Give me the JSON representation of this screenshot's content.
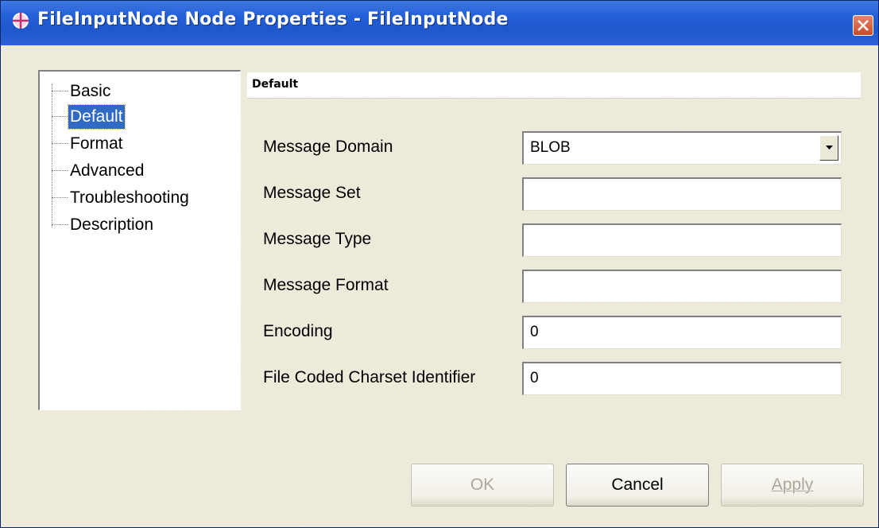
{
  "window": {
    "title": "FileInputNode Node Properties - FileInputNode",
    "title_icon": "node-crosshair-icon",
    "close_icon": "close-icon",
    "titlebar_color": "#2360d8",
    "close_color": "#c84a2a"
  },
  "tree": {
    "items": [
      {
        "label": "Basic",
        "selected": false
      },
      {
        "label": "Default",
        "selected": true
      },
      {
        "label": "Format",
        "selected": false
      },
      {
        "label": "Advanced",
        "selected": false
      },
      {
        "label": "Troubleshooting",
        "selected": false
      },
      {
        "label": "Description",
        "selected": false
      }
    ],
    "selection_color": "#316ac5"
  },
  "section": {
    "title": "Default"
  },
  "fields": [
    {
      "label": "Message Domain",
      "value": "BLOB",
      "type": "dropdown"
    },
    {
      "label": "Message Set",
      "value": "",
      "type": "text"
    },
    {
      "label": "Message Type",
      "value": "",
      "type": "text"
    },
    {
      "label": "Message Format",
      "value": "",
      "type": "text"
    },
    {
      "label": "Encoding",
      "value": "0",
      "type": "text"
    },
    {
      "label": "File Coded Charset Identifier",
      "value": "0",
      "type": "text"
    }
  ],
  "buttons": {
    "ok": {
      "label": "OK",
      "enabled": false
    },
    "cancel": {
      "label": "Cancel",
      "enabled": true
    },
    "apply": {
      "label": "Apply",
      "enabled": false
    }
  }
}
